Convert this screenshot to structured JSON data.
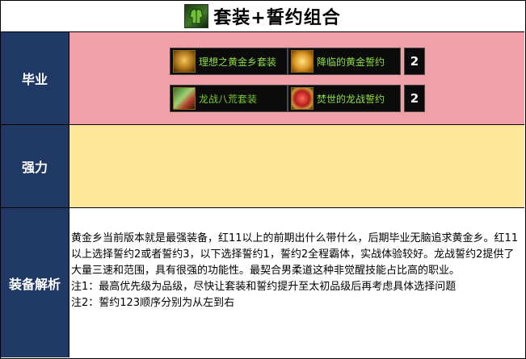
{
  "title": {
    "text": "套装+誓约组合",
    "icon": "green-armor-icon"
  },
  "rows": {
    "graduate": {
      "label": "毕业",
      "items": [
        {
          "name": "理想之黄金乡套装",
          "icon": "golden-armor-icon"
        },
        {
          "name": "降临的黄金誓约",
          "icon": "golden-pledge-icon"
        },
        {
          "count": "2"
        },
        {
          "name": "龙战八荒套装",
          "icon": "dragon-armor-icon"
        },
        {
          "name": "焚世的龙战誓约",
          "icon": "dragon-pledge-icon"
        },
        {
          "count": "2"
        }
      ]
    },
    "strong": {
      "label": "强力"
    },
    "analysis": {
      "label": "装备解析",
      "text": [
        "黄金乡当前版本就是最强装备，红11以上的前期出什么带什么，后期毕业无脑追求黄金乡。红11以上选择誓约2或者誓约3，以下选择誓约1，誓约2全程霸体，实战体验较好。龙战誓约2提供了大量三速和范围，具有很强的功能性。最契合男柔道这种非觉醒技能占比高的职业。",
        "注1：最高优先级为品级，尽快让套装和誓约提升至太初品级后再考虑具体选择问题",
        "注2：誓约123顺序分别为从左到右"
      ]
    }
  },
  "colors": {
    "label_bg": "#1f3864",
    "graduate_bg": "#f1a0a8",
    "strong_bg": "#ffe699",
    "item_text": "#8ede42"
  }
}
